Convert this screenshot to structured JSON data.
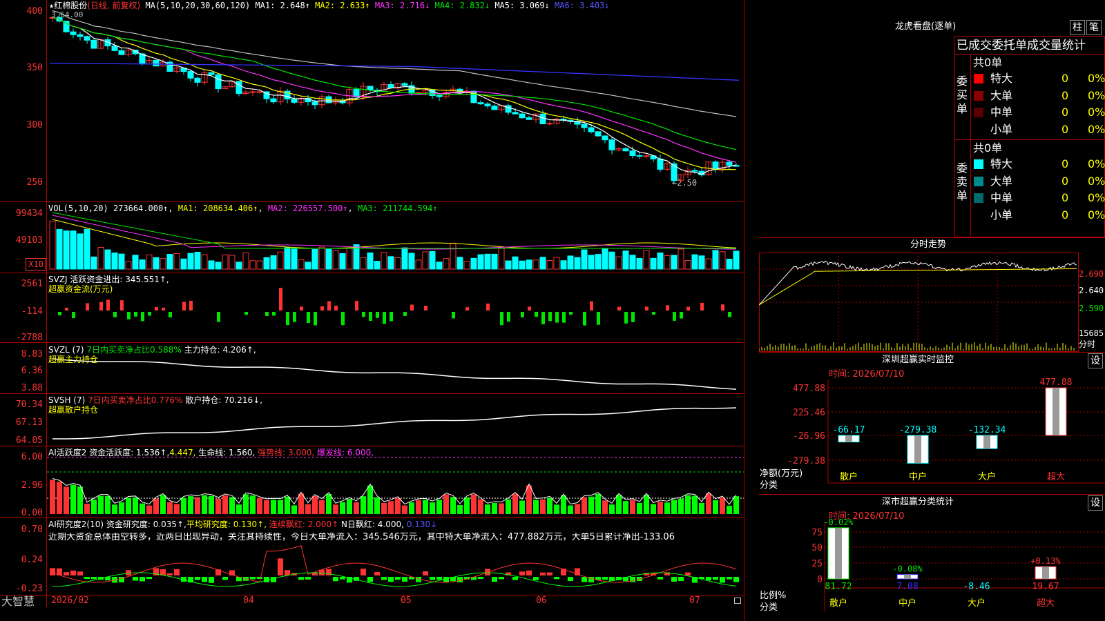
{
  "stock": {
    "star": "★",
    "name": "红棉股份",
    "period": "(日线, 前复权)"
  },
  "ma_header": {
    "label": "MA(5,10,20,30,60,120)",
    "ma1": "MA1: 2.648↑",
    "ma2": "MA2: 2.633↑",
    "ma3": "MA3: 2.716↓",
    "ma4": "MA4: 2.832↓",
    "ma5": "MA5: 3.069↓",
    "ma6": "MA6: 3.403↓",
    "hi_mark": "3.64.00",
    "lo_mark": "←2.50"
  },
  "price_axis": [
    "400",
    "350",
    "300",
    "250"
  ],
  "vol": {
    "label": "VOL(5,10,20)",
    "value": "273664.000↑",
    "ma1": "MA1: 208634.406↑",
    "ma2": "MA2: 226557.500↑",
    "ma3": "MA3: 211744.594↑",
    "axis": [
      "99434",
      "49103"
    ],
    "unit": "X10"
  },
  "svzj": {
    "title": "SVZJ  活跃资金进出: 345.551↑,",
    "sub": "超赢资金流(万元)",
    "axis": [
      "2561",
      "-114",
      "-2788"
    ]
  },
  "svzl": {
    "title": "SVZL (7)",
    "ratio": "7日内买卖净占比0.588%",
    "hold": "主力持仓: 4.206↑,",
    "sub": "超赢主力持仓",
    "axis": [
      "8.83",
      "6.36",
      "3.88"
    ]
  },
  "svsh": {
    "title": "SVSH (7)",
    "ratio": "7日内买卖净占比0.776%",
    "hold": "散户持仓: 70.216↓,",
    "sub": "超赢散户持仓",
    "axis": [
      "70.34",
      "67.13",
      "64.05"
    ]
  },
  "ai1": {
    "title": "AI活跃度2 资金活跃度: 1.536↑,",
    "v2": "4.447,",
    "v3": "生命线: 1.560,",
    "v4": "强势线: 3.000,",
    "v5": "爆发线: 6.000,",
    "axis": [
      "6.00",
      "2.96",
      "0.00"
    ]
  },
  "ai2": {
    "title": "AI研究度2(10) 资金研究度: 0.035↑,",
    "v2": "平均研究度: 0.130↑,",
    "v3": "连续飘红: 2.000↑",
    "v4": "N日飘红: 4.000,",
    "v5": "0.130↓",
    "comment": "近期大资金总体由空转多，近两日出现异动，关注其持续性，今日大单净流入：345.546万元，其中特大单净流入：477.882万元，大单5日累计净出-133.06",
    "axis": [
      "0.70",
      "0.24",
      "-0.23"
    ]
  },
  "date_axis": [
    "2026/02",
    "04",
    "05",
    "06",
    "07"
  ],
  "brand": "大智慧",
  "dragon": {
    "title": "龙虎看盘(逐单)",
    "btn_zhu": "柱",
    "btn_bi": "笔",
    "header": "已成交委托单成交量统计",
    "buy": {
      "side": "委买单",
      "total": "共0单",
      "rows": [
        {
          "label": "特大",
          "count": "0",
          "pct": "0%",
          "color": "#ff0000"
        },
        {
          "label": "大单",
          "count": "0",
          "pct": "0%",
          "color": "#8b0000"
        },
        {
          "label": "中单",
          "count": "0",
          "pct": "0%",
          "color": "#5a0000"
        },
        {
          "label": "小单",
          "count": "0",
          "pct": "0%",
          "color": "#000000"
        }
      ]
    },
    "sell": {
      "side": "委卖单",
      "total": "共0单",
      "rows": [
        {
          "label": "特大",
          "count": "0",
          "pct": "0%",
          "color": "#00ffff"
        },
        {
          "label": "大单",
          "count": "0",
          "pct": "0%",
          "color": "#008b8b"
        },
        {
          "label": "中单",
          "count": "0",
          "pct": "0%",
          "color": "#006b6b"
        },
        {
          "label": "小单",
          "count": "0",
          "pct": "0%",
          "color": "#000000"
        }
      ]
    }
  },
  "intraday": {
    "title": "分时走势",
    "axis": [
      "2.690",
      "2.640",
      "2.590"
    ],
    "vol_top": "15685",
    "vol_lbl": "分时"
  },
  "monitor": {
    "title": "深圳超赢实时监控",
    "btn": "设",
    "time": "时间: 2026/07/10",
    "axis": [
      "477.88",
      "225.46",
      "-26.96",
      "-279.38"
    ],
    "ylabel": "净额(万元)",
    "xlabel": "分类",
    "bars": [
      {
        "cat": "散户",
        "value": -66.17,
        "label": "-66.17"
      },
      {
        "cat": "中户",
        "value": -279.38,
        "label": "-279.38"
      },
      {
        "cat": "大户",
        "value": -132.34,
        "label": "-132.34"
      },
      {
        "cat": "超大",
        "value": 477.88,
        "label": "477.88"
      }
    ]
  },
  "classify": {
    "title": "深市超赢分类统计",
    "btn": "设",
    "time": "时间: 2026/07/10",
    "axis": [
      "75",
      "50",
      "25",
      "0"
    ],
    "ylabel": "比例%",
    "xlabel": "分类",
    "bars": [
      {
        "cat": "散户",
        "value": 81.72,
        "pct": "-0.02%",
        "bottom": "81.72"
      },
      {
        "cat": "中户",
        "value": 7.08,
        "pct": "-0.08%",
        "bottom": "7.08"
      },
      {
        "cat": "大户",
        "value": -8.46,
        "pct": "",
        "bottom": "-8.46"
      },
      {
        "cat": "超大",
        "value": 19.67,
        "pct": "+0.13%",
        "bottom": "19.67"
      }
    ]
  }
}
